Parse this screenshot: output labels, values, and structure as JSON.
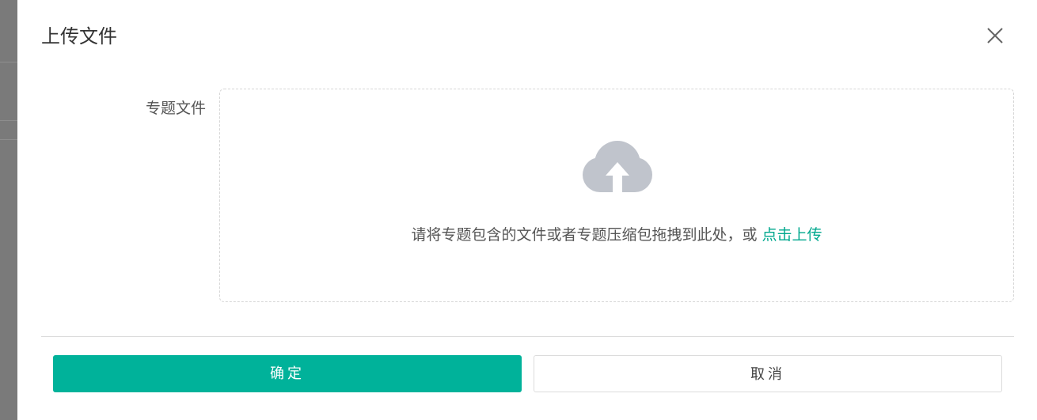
{
  "dialog": {
    "title": "上传文件",
    "close_icon": "close-icon"
  },
  "form": {
    "field_label": "专题文件"
  },
  "dropzone": {
    "icon": "cloud-upload-icon",
    "text": "请将专题包含的文件或者专题压缩包拖拽到此处，或 ",
    "link_text": "点击上传"
  },
  "actions": {
    "confirm_label": "确定",
    "cancel_label": "取消"
  },
  "colors": {
    "accent": "#00b29a",
    "link": "#00a88e",
    "icon_gray": "#c0c4cc"
  }
}
